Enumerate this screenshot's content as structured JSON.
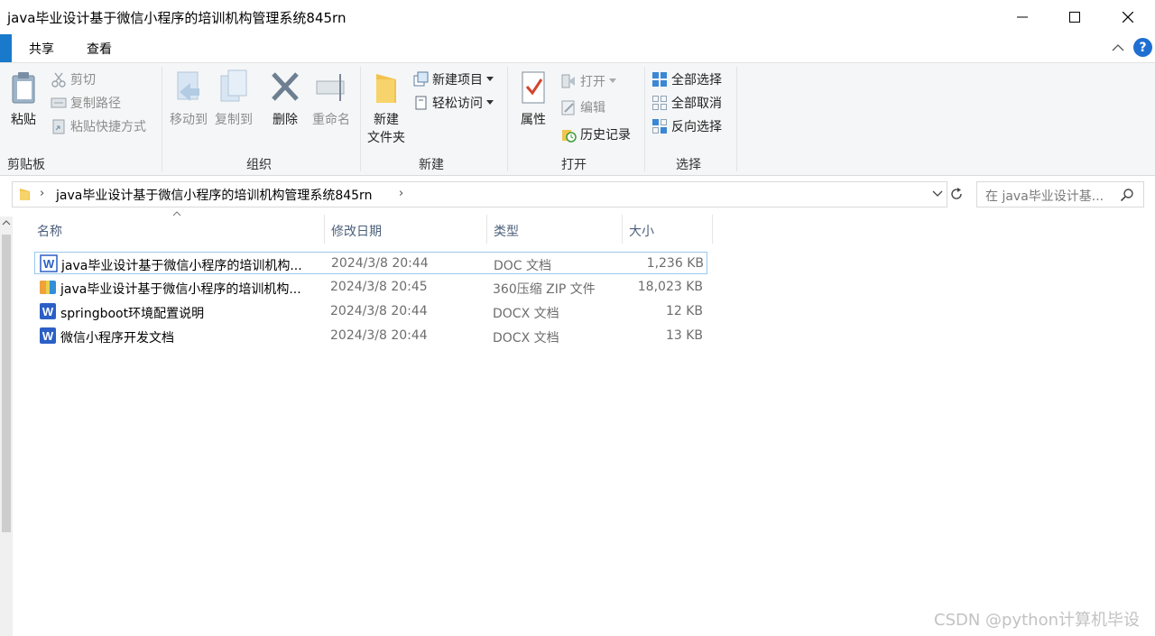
{
  "window": {
    "title": "java毕业设计基于微信小程序的培训机构管理系统845rn"
  },
  "ribbon_tabs": [
    "共享",
    "查看"
  ],
  "ribbon": {
    "clipboard": {
      "paste": "粘贴",
      "cut": "剪切",
      "copy_path": "复制路径",
      "paste_shortcut": "粘贴快捷方式",
      "label": "剪贴板"
    },
    "organize": {
      "move_to": "移动到",
      "copy_to": "复制到",
      "delete": "删除",
      "rename": "重命名",
      "label": "组织"
    },
    "new": {
      "new_folder_line1": "新建",
      "new_folder_line2": "文件夹",
      "new_item": "新建项目",
      "easy_access": "轻松访问",
      "label": "新建"
    },
    "open": {
      "properties": "属性",
      "open": "打开",
      "edit": "编辑",
      "history": "历史记录",
      "label": "打开"
    },
    "select": {
      "select_all": "全部选择",
      "select_none": "全部取消",
      "invert": "反向选择",
      "label": "选择"
    }
  },
  "address": {
    "path": "java毕业设计基于微信小程序的培训机构管理系统845rn"
  },
  "search": {
    "placeholder": "在 java毕业设计基..."
  },
  "columns": {
    "name": "名称",
    "modified": "修改日期",
    "type": "类型",
    "size": "大小"
  },
  "files": [
    {
      "name": "java毕业设计基于微信小程序的培训机构...",
      "modified": "2024/3/8 20:44",
      "type": "DOC 文档",
      "size": "1,236 KB",
      "icon": "word-doc-icon"
    },
    {
      "name": "java毕业设计基于微信小程序的培训机构...",
      "modified": "2024/3/8 20:45",
      "type": "360压缩 ZIP 文件",
      "size": "18,023 KB",
      "icon": "zip-archive-icon"
    },
    {
      "name": "springboot环境配置说明",
      "modified": "2024/3/8 20:44",
      "type": "DOCX 文档",
      "size": "12 KB",
      "icon": "word-docx-icon"
    },
    {
      "name": "微信小程序开发文档",
      "modified": "2024/3/8 20:44",
      "type": "DOCX 文档",
      "size": "13 KB",
      "icon": "word-docx-icon"
    }
  ],
  "watermark": "CSDN @python计算机毕设",
  "colors": {
    "accent": "#1f6fd1",
    "selection_border": "#99c9ef",
    "word_blue": "#2b5fc7"
  }
}
